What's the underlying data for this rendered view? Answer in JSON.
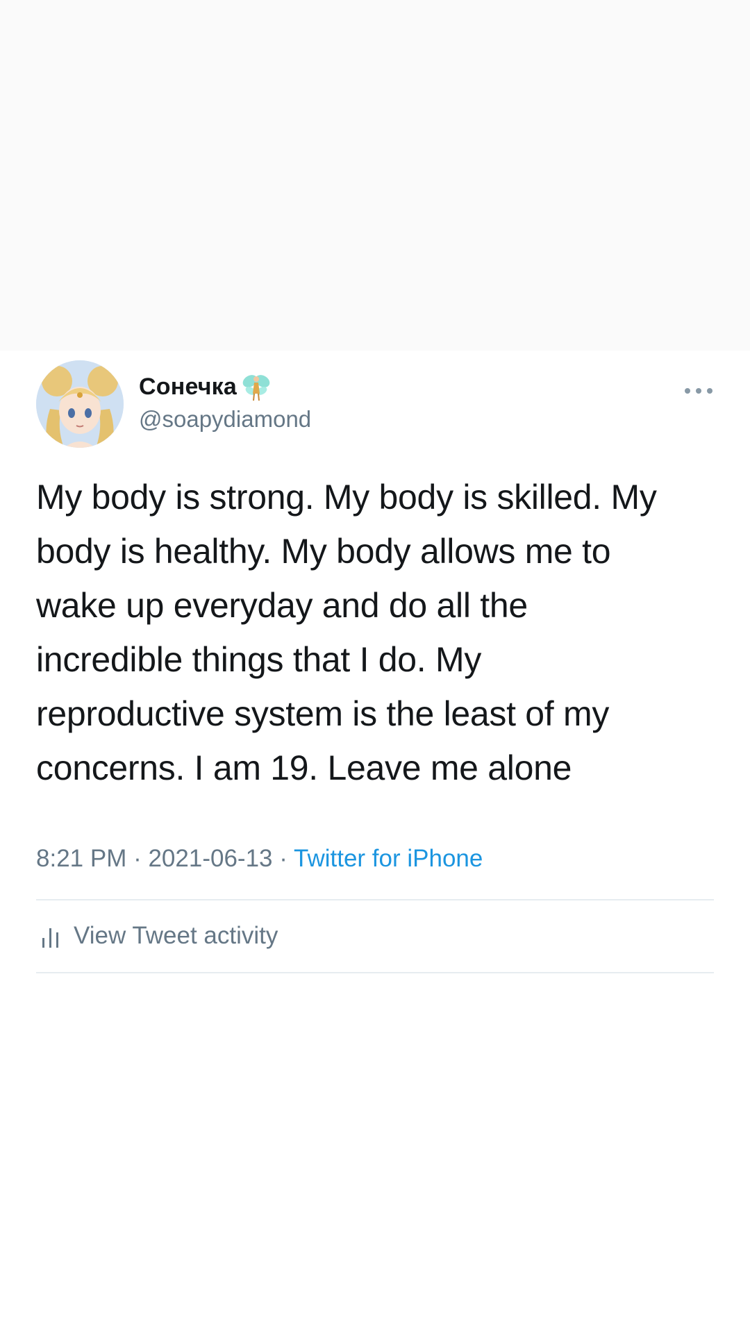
{
  "tweet": {
    "display_name": "Сонечка",
    "handle": "@soapydiamond",
    "text_lines": [
      "My body is strong. My body is skilled. My",
      "body is healthy. My body allows me to",
      "wake up everyday and do all the",
      "incredible things that I do. My",
      "reproductive system is the least of my",
      "concerns. I am 19. Leave me alone"
    ],
    "time": "8:21 PM",
    "separator": " · ",
    "date": "2021-06-13",
    "source": "Twitter for iPhone"
  },
  "activity": {
    "label": "View Tweet activity"
  },
  "icons": {
    "avatar": "profile-avatar-anime",
    "name_emoji": "fairy-emoji",
    "more": "more-dots-icon",
    "activity": "bar-chart-icon"
  },
  "colors": {
    "text_primary": "#14171a",
    "text_secondary": "#657786",
    "link": "#1b95e0",
    "divider": "#e6ecf0"
  }
}
